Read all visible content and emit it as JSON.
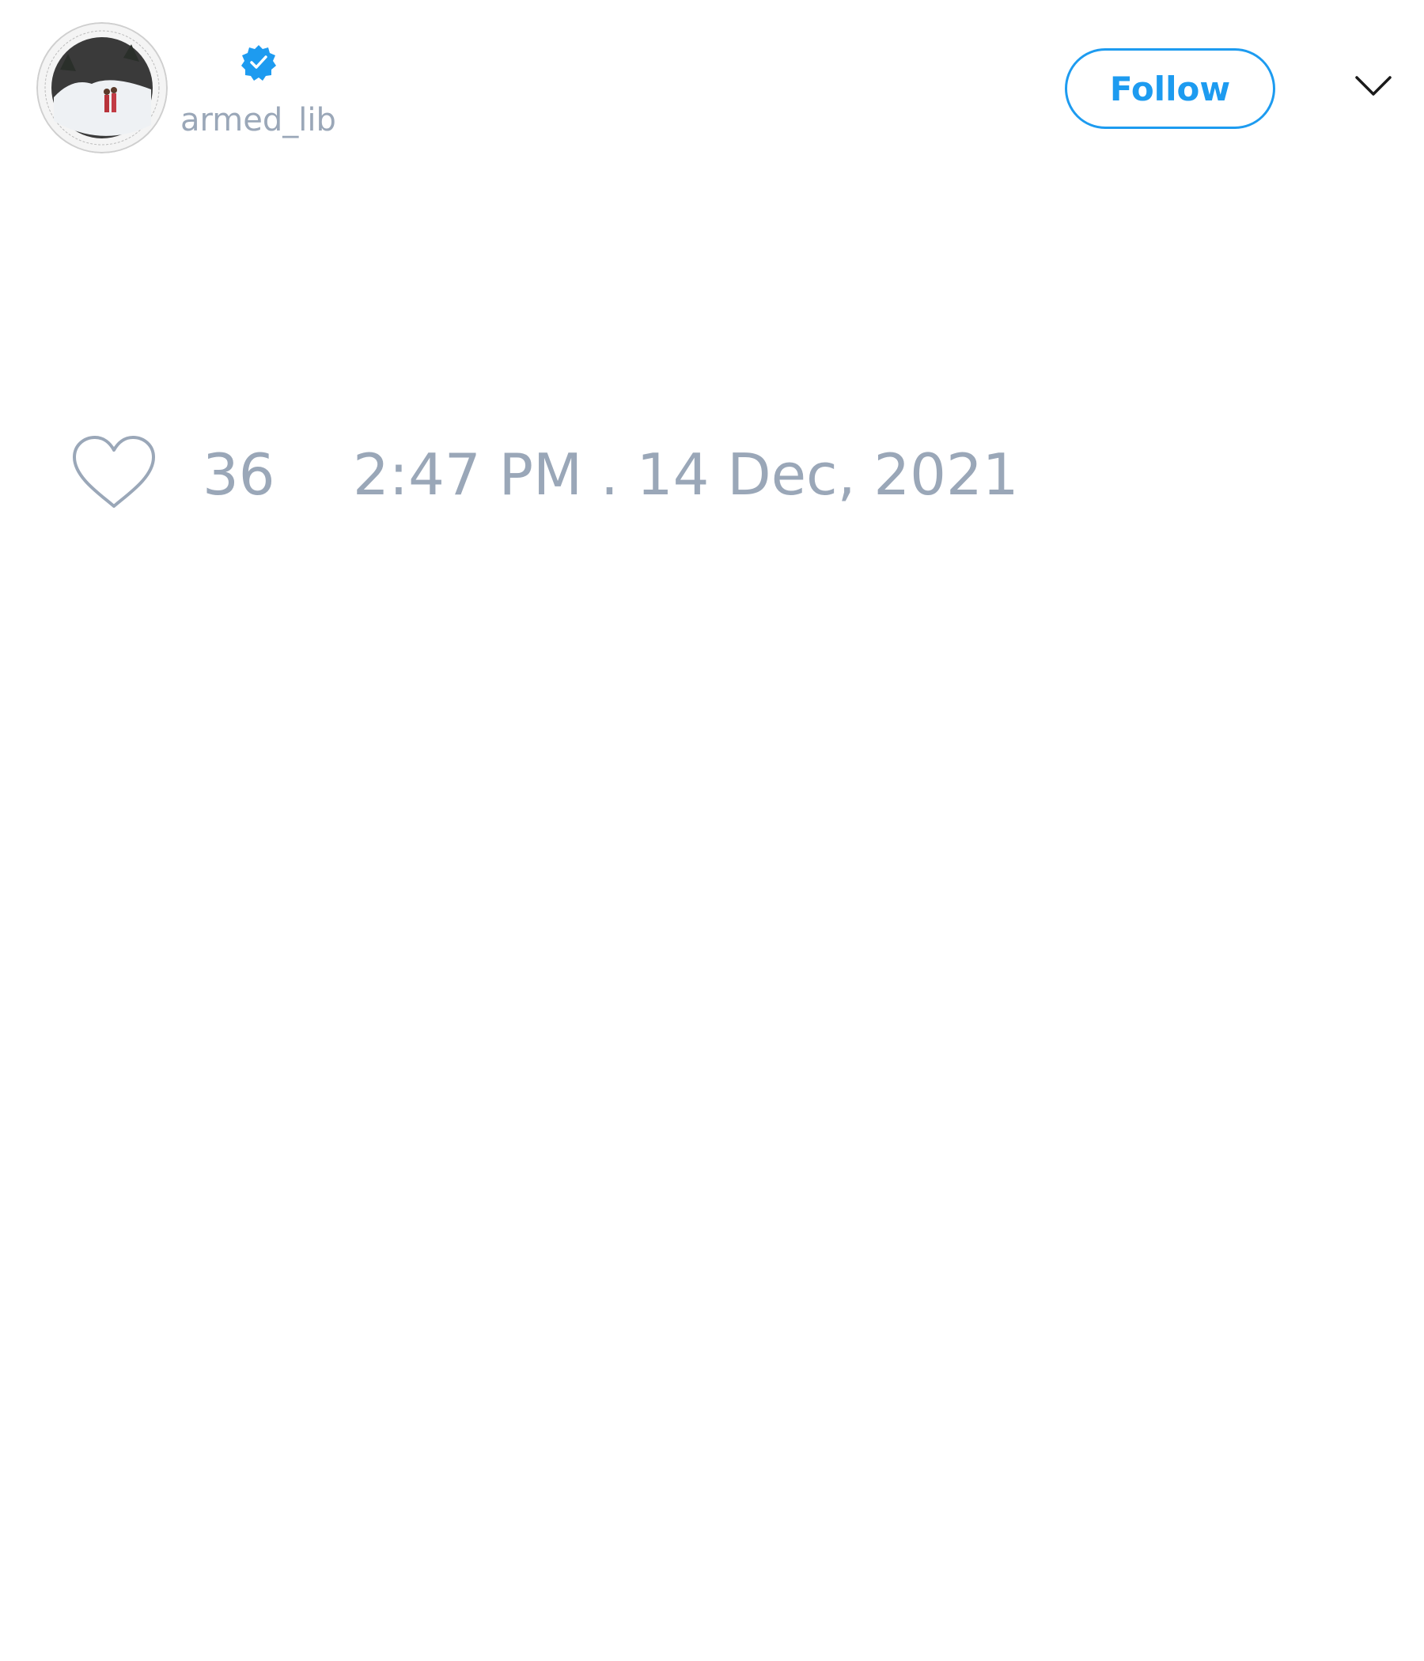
{
  "author": {
    "handle": "armed_lib",
    "verified": true,
    "avatar_icon": "profile-photo",
    "verified_icon": "verified-badge-icon"
  },
  "header": {
    "follow_label": "Follow",
    "menu_icon": "chevron-down-icon"
  },
  "actions": {
    "like_icon": "heart-outline-icon",
    "like_count": "36",
    "timestamp": "2:47 PM . 14 Dec, 2021"
  },
  "colors": {
    "accent": "#1d9bf0",
    "muted_text": "#9aa7b8",
    "background": "#ffffff"
  }
}
